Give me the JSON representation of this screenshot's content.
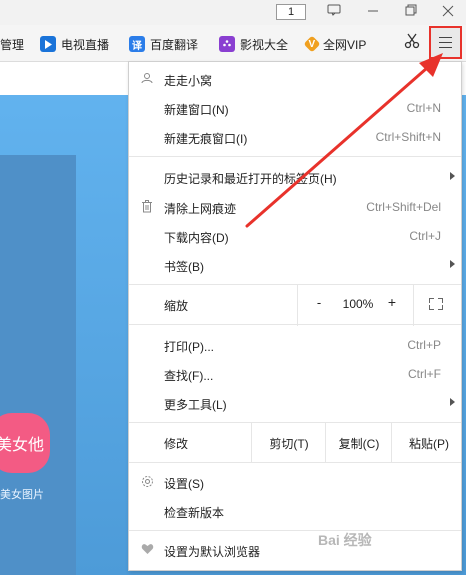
{
  "titlebar": {
    "tab_count": "1",
    "chat_icon": "chat-icon",
    "minimize_icon": "minimize-icon",
    "maximize_icon": "maximize-icon",
    "close_icon": "close-icon"
  },
  "bookmarks": [
    {
      "label": "管理",
      "icon": "none"
    },
    {
      "label": "电视直播",
      "icon": "tv-play-icon"
    },
    {
      "label": "百度翻译",
      "icon": "translate-icon"
    },
    {
      "label": "影视大全",
      "icon": "film-icon"
    },
    {
      "label": "全网VIP",
      "icon": "vip-icon"
    }
  ],
  "toolbar": {
    "scissors_icon": "scissors-icon",
    "menu_icon": "hamburger-menu-icon"
  },
  "page": {
    "logo_text": "美女他",
    "logo_caption": "美女图片"
  },
  "menu": {
    "user": "走走小窝",
    "new_window": {
      "label": "新建窗口(N)",
      "shortcut": "Ctrl+N"
    },
    "incognito": {
      "label": "新建无痕窗口(I)",
      "shortcut": "Ctrl+Shift+N"
    },
    "history": {
      "label": "历史记录和最近打开的标签页(H)"
    },
    "clear": {
      "label": "清除上网痕迹",
      "shortcut": "Ctrl+Shift+Del"
    },
    "downloads": {
      "label": "下载内容(D)",
      "shortcut": "Ctrl+J"
    },
    "bookmarks": {
      "label": "书签(B)"
    },
    "zoom": {
      "label": "缩放",
      "minus": "-",
      "value": "100%",
      "plus": "+"
    },
    "print": {
      "label": "打印(P)...",
      "shortcut": "Ctrl+P"
    },
    "find": {
      "label": "查找(F)...",
      "shortcut": "Ctrl+F"
    },
    "more_tools": {
      "label": "更多工具(L)"
    },
    "edit": {
      "label": "修改",
      "cut": "剪切(T)",
      "copy": "复制(C)",
      "paste": "粘贴(P)"
    },
    "settings": {
      "label": "设置(S)"
    },
    "check_update": {
      "label": "检查新版本"
    },
    "default_browser": {
      "label": "设置为默认浏览器"
    }
  },
  "colors": {
    "annotation_arrow": "#e8322b",
    "page_bg": "#5aa8e6"
  },
  "watermark": "Bai 经验"
}
